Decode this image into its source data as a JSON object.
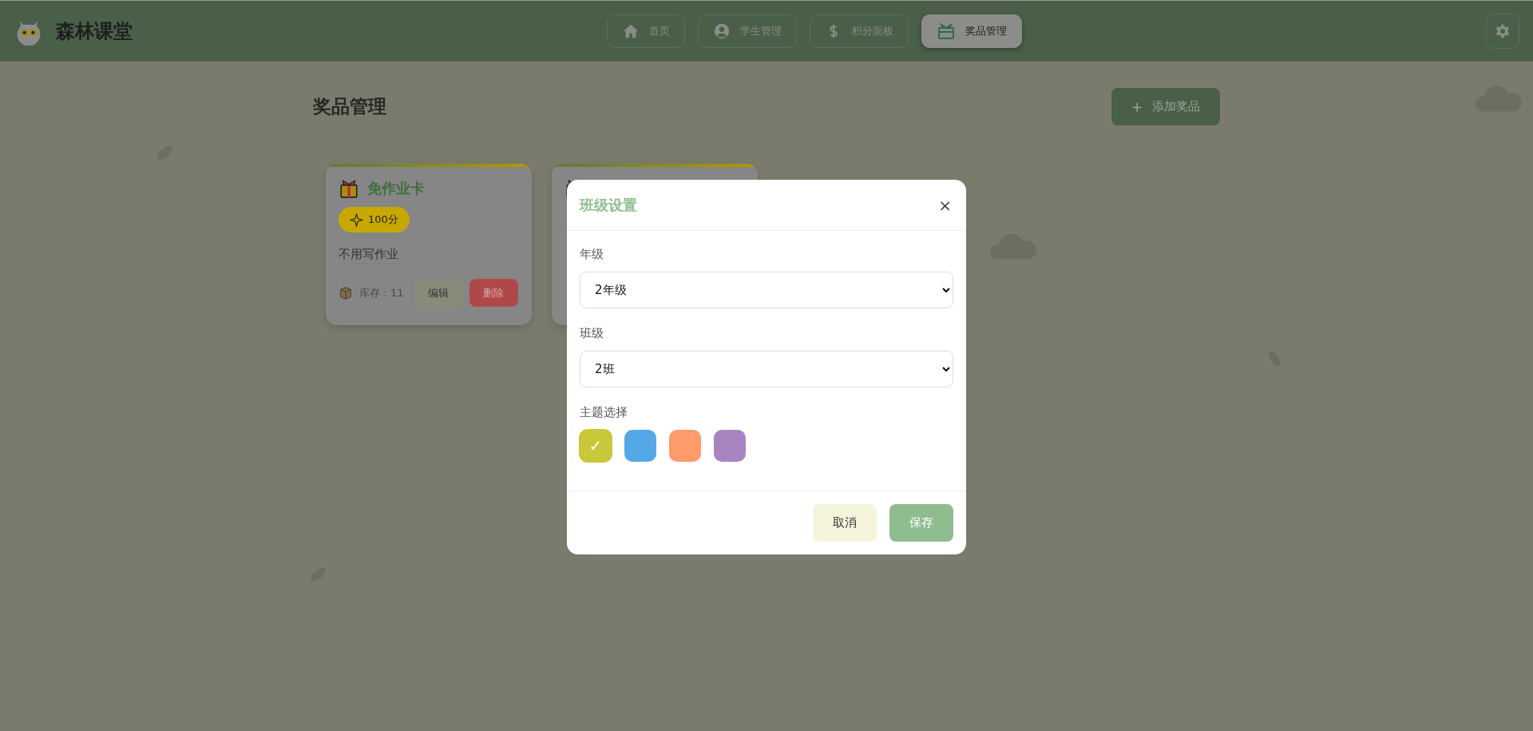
{
  "app": {
    "title": "森林课堂"
  },
  "nav": [
    {
      "label": "首页",
      "kind": "home",
      "selected": false
    },
    {
      "label": "学生管理",
      "kind": "user",
      "selected": false
    },
    {
      "label": "积分面板",
      "kind": "dollar",
      "selected": false
    },
    {
      "label": "奖品管理",
      "kind": "gift",
      "selected": true
    }
  ],
  "page": {
    "title": "奖品管理",
    "add_button": {
      "icon": "+",
      "label": "添加奖品"
    }
  },
  "prizes": [
    {
      "kind": "full",
      "name": "免作业卡",
      "points": "100分",
      "description": "不用写作业",
      "stock": "库存：11",
      "edit": "编辑",
      "delete": "删除"
    },
    {
      "kind": "covered"
    }
  ],
  "dialog": {
    "title": "班级设置",
    "close": "×",
    "fields": [
      {
        "label": "年级",
        "value": "2年级"
      },
      {
        "label": "班级",
        "value": "2班"
      }
    ],
    "theme": {
      "label": "主题选择",
      "check_mark": "✓",
      "options": [
        {
          "color": "#c8c83a",
          "selected": true
        },
        {
          "color": "#55a8e8",
          "selected": false
        },
        {
          "color": "#ff9a6a",
          "selected": false
        },
        {
          "color": "#a885c0",
          "selected": false
        }
      ]
    },
    "buttons": [
      {
        "label": "取消",
        "kind": "secondary"
      },
      {
        "label": "保存",
        "kind": "primary"
      }
    ]
  }
}
